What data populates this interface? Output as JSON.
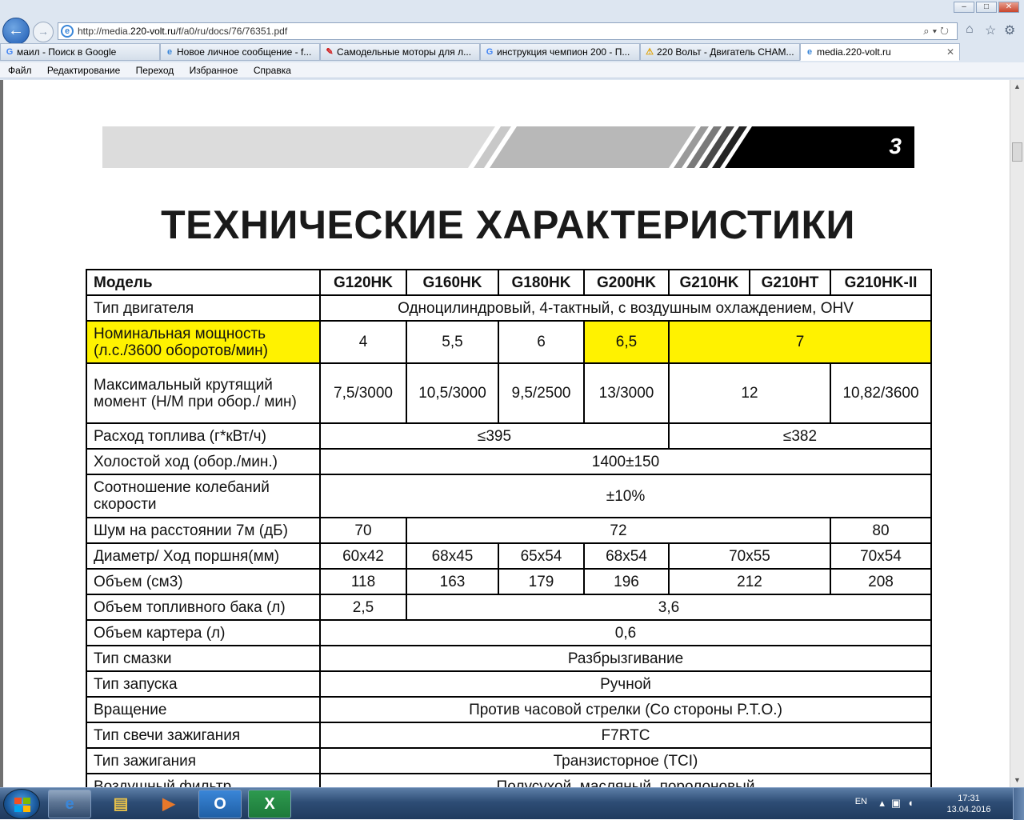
{
  "browser": {
    "url_prefix": "http://media.",
    "url_domain": "220-volt.ru",
    "url_path": "/f/a0/ru/docs/76/76351.pdf",
    "tabs": [
      {
        "label": "маил - Поиск в Google",
        "icon": "G",
        "icon_color": "#4285f4"
      },
      {
        "label": "Новое личное сообщение - f...",
        "icon": "e",
        "icon_color": "#3a86d8"
      },
      {
        "label": "Самодельные моторы для л...",
        "icon": "✎",
        "icon_color": "#d02020"
      },
      {
        "label": "инструкция чемпион 200 - П...",
        "icon": "G",
        "icon_color": "#4285f4"
      },
      {
        "label": "220 Вольт - Двигатель CHAM...",
        "icon": "⚠",
        "icon_color": "#e0a000"
      },
      {
        "label": "media.220-volt.ru",
        "icon": "e",
        "icon_color": "#3a86d8"
      }
    ],
    "menu": [
      "Файл",
      "Редактирование",
      "Переход",
      "Избранное",
      "Справка"
    ]
  },
  "document": {
    "page_number": "3",
    "title": "ТЕХНИЧЕСКИЕ ХАРАКТЕРИСТИКИ",
    "highlight_color": "#fff200",
    "header": {
      "label": "Модель",
      "models": [
        "G120HK",
        "G160HK",
        "G180HK",
        "G200HK",
        "G210HK",
        "G210HT",
        "G210HK-II"
      ]
    },
    "rows": {
      "engine_type": {
        "label": "Тип двигателя",
        "value": "Одноцилиндровый, 4-тактный, с воздушным охлаждением, OHV"
      },
      "power": {
        "label": "Номинальная мощность (л.с./3600 оборотов/мин)",
        "v1": "4",
        "v2": "5,5",
        "v3": "6",
        "v4": "6,5",
        "v5": "7"
      },
      "torque": {
        "label": "Максимальный крутящий момент (Н/М при обор./ мин)",
        "v1": "7,5/3000",
        "v2": "10,5/3000",
        "v3": "9,5/2500",
        "v4": "13/3000",
        "v5": "12",
        "v6": "10,82/3600"
      },
      "fuel_consumption": {
        "label": "Расход топлива (г*кВт/ч)",
        "v1": "≤395",
        "v2": "≤382"
      },
      "idle": {
        "label": "Холостой ход (обор./мин.)",
        "value": "1400±150"
      },
      "speed_variation": {
        "label": "Соотношение колебаний скорости",
        "value": "±10%"
      },
      "noise": {
        "label": "Шум на расстоянии 7м (дБ)",
        "v1": "70",
        "v2": "72",
        "v3": "80"
      },
      "bore_stroke": {
        "label": "Диаметр/ Ход поршня(мм)",
        "v1": "60x42",
        "v2": "68x45",
        "v3": "65x54",
        "v4": "68x54",
        "v5": "70x55",
        "v6": "70x54"
      },
      "displacement": {
        "label": "Объем (см3)",
        "v1": "118",
        "v2": "163",
        "v3": "179",
        "v4": "196",
        "v5": "212",
        "v6": "208"
      },
      "tank": {
        "label": "Объем топливного бака (л)",
        "v1": "2,5",
        "v2": "3,6"
      },
      "crankcase": {
        "label": "Объем картера (л)",
        "value": "0,6"
      },
      "lubrication": {
        "label": "Тип смазки",
        "value": "Разбрызгивание"
      },
      "starting": {
        "label": "Тип запуска",
        "value": "Ручной"
      },
      "rotation": {
        "label": "Вращение",
        "value": "Против часовой стрелки (Со стороны P.T.O.)"
      },
      "spark_plug": {
        "label": "Тип свечи зажигания",
        "value": "F7RTC"
      },
      "ignition": {
        "label": "Тип зажигания",
        "value": "Транзисторное (TCI)"
      },
      "air_filter": {
        "label": "Воздушный фильтр",
        "value": "Полусухой, масляный, поролоновый"
      }
    }
  },
  "taskbar": {
    "lang": "EN",
    "time": "17:31",
    "date": "13.04.2016",
    "apps": [
      {
        "name": "internet-explorer",
        "glyph": "e",
        "color": "#3a86d8"
      },
      {
        "name": "file-explorer",
        "glyph": "▤",
        "color": "#e8c24a"
      },
      {
        "name": "media-player",
        "glyph": "▶",
        "color": "#e8782a"
      },
      {
        "name": "outlook",
        "glyph": "O",
        "color": "#1f6fc5"
      },
      {
        "name": "excel",
        "glyph": "X",
        "color": "#1d7a3a"
      }
    ]
  }
}
